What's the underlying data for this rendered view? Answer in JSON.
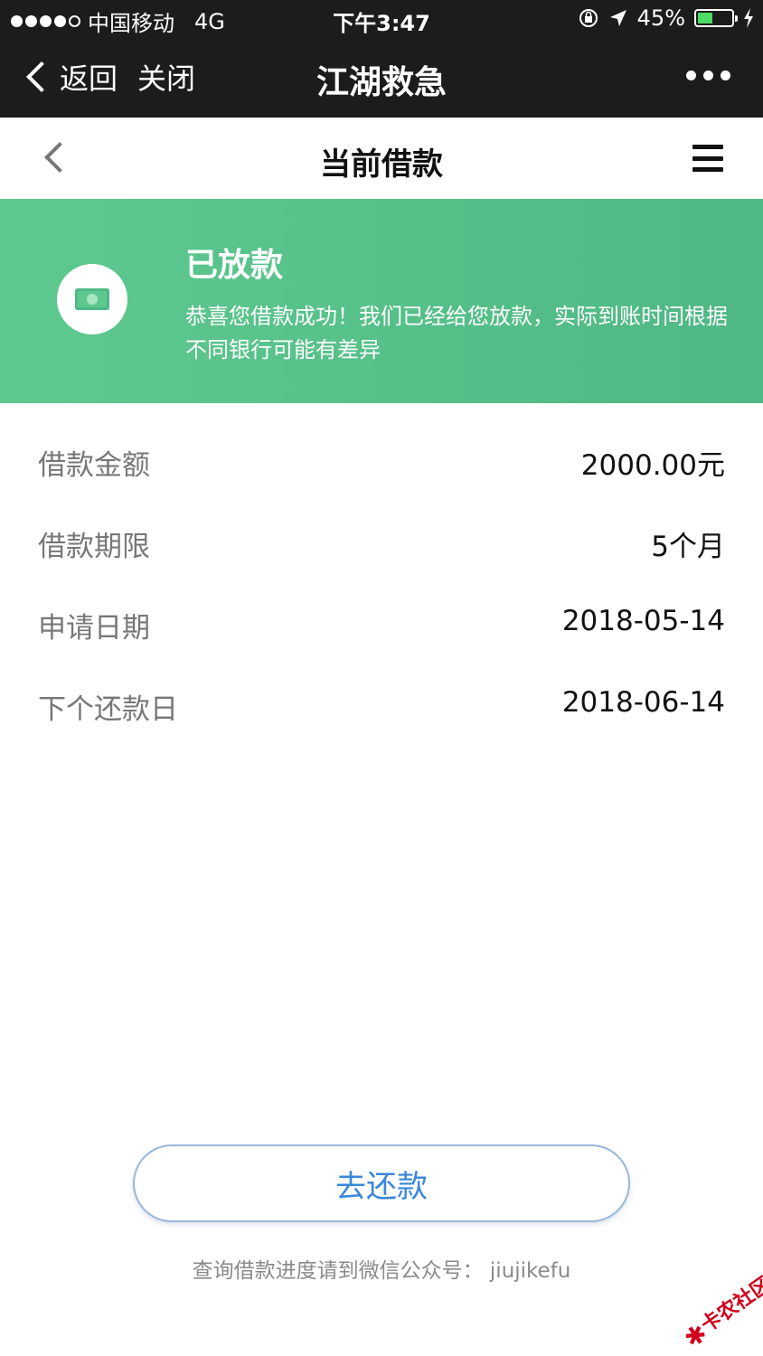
{
  "status_bar": {
    "carrier": "中国移动",
    "network": "4G",
    "time": "下午3:47",
    "battery": "45%",
    "battery_level": 0.45
  },
  "wechat_header": {
    "back_label": "返回",
    "close_label": "关闭",
    "title": "江湖救急"
  },
  "page": {
    "title": "当前借款"
  },
  "banner": {
    "status": "已放款",
    "message": "恭喜您借款成功！我们已经给您放款，实际到账时间根据不同银行可能有差异",
    "background_color": "#5ec98f"
  },
  "loan_info": [
    {
      "label": "借款金额",
      "value": "2000.00元"
    },
    {
      "label": "借款期限",
      "value": "5个月"
    },
    {
      "label": "申请日期",
      "value": "2018-05-14"
    },
    {
      "label": "下个还款日",
      "value": "2018-06-14"
    }
  ],
  "actions": {
    "repay_label": "去还款"
  },
  "footer": {
    "note": "查询借款进度请到微信公众号： jiujikefu"
  },
  "watermark": {
    "text": "卡农社区"
  },
  "colors": {
    "accent_blue": "#3a86d8",
    "banner_green": "#5ec98f",
    "header_dark": "#1c1c1d"
  }
}
